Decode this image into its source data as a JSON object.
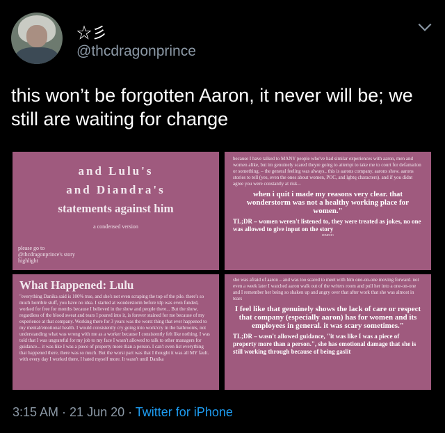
{
  "user": {
    "display_name": "☆彡",
    "handle": "@thcdragonprince"
  },
  "tweet": {
    "text": "this won’t be forgotten Aaron, it never will be; we still are waiting for change"
  },
  "images": {
    "panel1": {
      "line1": "and Lulu's",
      "line2": "and Diandra's",
      "line3": "statements against him",
      "subtitle": "a condensed version",
      "note": "please go to @thcdragonprince's story highlight"
    },
    "panel2": {
      "para": "because I have talked to MANY people who've had similar experiences with aaron, men and women alike, but im genuinely scared theyre going to attempt to take me to court for defamation or something. – the general feeling was always.. this is aarons company. aarons show. aarons stories to tell (yes, even the ones about women, POC, and lgbtq characters). and if you didnt agree you were constantly at risk.–",
      "quote": "when i quit i made my reasons very clear. that wonderstorm was not a healthy working place for women.\"",
      "tldr": "TL;DR – women weren't listened to, they were treated as jokes, no one was allowed to give input on the story",
      "source_label": "source:"
    },
    "panel3": {
      "title": "What Happened: Lulu",
      "para": "\"everything Danika said is 100% true, and she's not even scraping the top of the pile. there's so much horrible stuff, you have no idea. I started at wonderstorm before tdp was even funded, worked for free for months because I believed in the show and people there... But the show, regardless of the blood sweat and tears I poured into it, is forever stained for me because of my experience at that company. Working there for 3 years was the worst thing that ever happened to my mental/emotional health. I would consistently cry going into work/cry in the bathrooms, not understanding what was wrong with me as a worker because I consistently felt like nothing. I was told that I was ungrateful for my job to my face I wasn't allowed to talk to other managers for guidance... it was like I was a piece of property more than a person. I can't even list everything that happened there, there was so much. But the worst part was that I thought it was all MY fault. with every day I worked there, I hated myself more. It wasn't until Danika"
    },
    "panel4": {
      "para": "she was afraid of aaron – and was too scared to meet with him one-on-one moving forward. not even a week later I watched aaron walk out of the writers room and pull her into a one-on-one and I remember her being so shaken up and angry over that after work that she was almost in tears",
      "quote": "I feel like that genuinely shows the lack of care or respect that company (especially aaron) has for women and its employees in general. it was scary sometimes.\"",
      "tldr": "TL;DR – wasn't allowed guidance, \"it was like I was a piece of property more than a person.\", she has emotional damage that she is still working through because of being gaslit"
    }
  },
  "meta": {
    "time": "3:15 AM",
    "separator": " · ",
    "date": "21 Jun 20",
    "source": "Twitter for iPhone"
  },
  "icons": {
    "chevron": "chevron-down-icon"
  },
  "colors": {
    "background": "#000000",
    "panel": "#9f5a7e",
    "secondary_text": "#8b98a5",
    "link": "#1d9bf0"
  }
}
